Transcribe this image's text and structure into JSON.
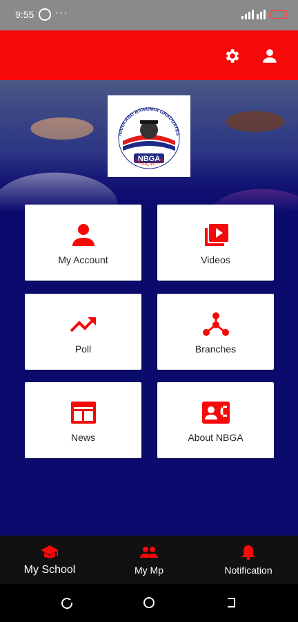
{
  "status_bar": {
    "time": "9:55",
    "more": "···"
  },
  "app_bar": {
    "settings_icon": "gear-icon",
    "profile_icon": "user-icon"
  },
  "hero": {
    "logo": {
      "top_text": "NANA AND BAWUMIA GRADUATES",
      "center_text": "NBGA",
      "bottom_text": "ASSOCIATION"
    }
  },
  "tiles": [
    {
      "label": "My Account",
      "icon": "account-icon"
    },
    {
      "label": "Videos",
      "icon": "video-library-icon"
    },
    {
      "label": "Poll",
      "icon": "trending-up-icon"
    },
    {
      "label": "Branches",
      "icon": "branches-icon"
    },
    {
      "label": "News",
      "icon": "news-icon"
    },
    {
      "label": "About NBGA",
      "icon": "contact-card-icon"
    }
  ],
  "bottom_nav": {
    "items": [
      {
        "label": "My School",
        "icon": "graduation-cap-icon",
        "active": true
      },
      {
        "label": "My Mp",
        "icon": "people-icon",
        "active": false
      },
      {
        "label": "Notification",
        "icon": "bell-icon",
        "active": false
      }
    ]
  },
  "colors": {
    "primary_red": "#f50909",
    "navy": "#0b0b6e",
    "tile_bg": "#ffffff",
    "nav_bg": "#111111"
  }
}
